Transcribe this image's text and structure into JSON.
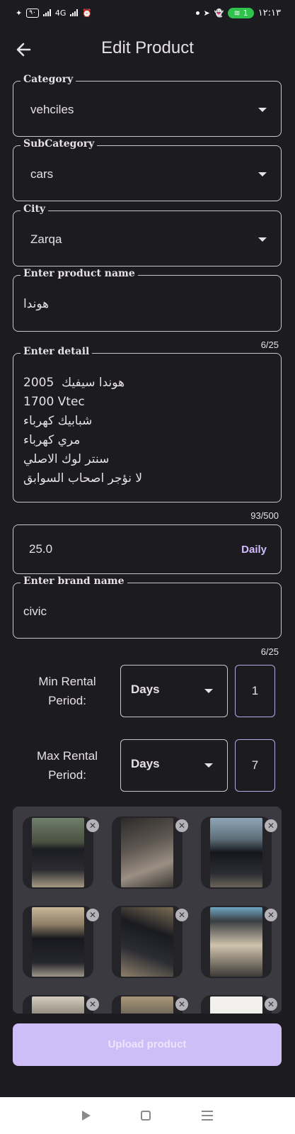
{
  "status_bar": {
    "time": "١٢:١٣",
    "battery": "٩٠",
    "network": "4G",
    "wifi_badge": "1"
  },
  "app_bar": {
    "title": "Edit Product",
    "back_icon": "arrow-left-icon"
  },
  "fields": {
    "category": {
      "label": "Category",
      "value": "vehciles"
    },
    "subcategory": {
      "label": "SubCategory",
      "value": "cars"
    },
    "city": {
      "label": "City",
      "value": "Zarqa"
    },
    "product_name": {
      "label": "Enter product name",
      "value": "هوندا",
      "counter": "6/25"
    },
    "detail": {
      "label": "Enter detail",
      "lines": [
        "هوندا سيفيك  2005",
        "1700 Vtec",
        "شبابيك كهرباء",
        "مري كهرباء",
        "سنتر لوك الاصلي",
        "لا نؤجر اصحاب السوابق"
      ],
      "counter": "93/500"
    },
    "price": {
      "value": "25.0",
      "unit": "Daily"
    },
    "brand_name": {
      "label": "Enter brand name",
      "value": "civic",
      "counter": "6/25"
    }
  },
  "rental": {
    "min": {
      "label": "Min Rental Period:",
      "unit": "Days",
      "value": "1"
    },
    "max": {
      "label": "Max Rental Period:",
      "unit": "Days",
      "value": "7"
    }
  },
  "images": {
    "remove_icon": "close-icon",
    "count_visible": 9
  },
  "actions": {
    "upload_label": "Upload product"
  },
  "colors": {
    "background": "#1c1b20",
    "accent": "#d0bcff",
    "upload_button": "#cfbdf7",
    "wifi_badge": "#2fc24d"
  }
}
